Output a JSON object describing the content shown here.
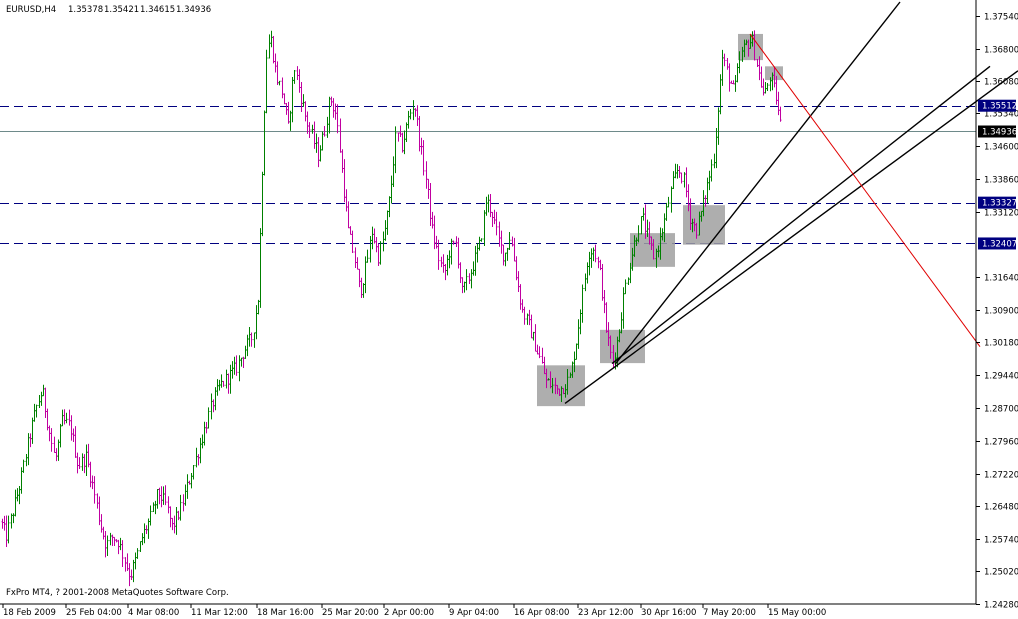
{
  "header": {
    "symbol": "EURUSD,H4",
    "open": "1.35378",
    "high": "1.35421",
    "low": "1.34615",
    "close": "1.34936"
  },
  "copyright": "FxPro MT4, ? 2001-2008 MetaQuotes Software Corp.",
  "colors": {
    "background": "#ffffff",
    "bull_bar": "#008000",
    "bear_bar": "#c000a0",
    "level_line": "#000080",
    "trendline": "#000000",
    "red_trendline": "#e00000",
    "box_fill": "#a0a0a0",
    "price_line": "#6e8a8a"
  },
  "chart_data": {
    "type": "ohlc",
    "title": "EURUSD,H4",
    "timeframe": "H4",
    "x_labels": [
      "18 Feb 2009",
      "25 Feb 04:00",
      "4 Mar 08:00",
      "11 Mar 12:00",
      "18 Mar 16:00",
      "25 Mar 20:00",
      "2 Apr 00:00",
      "9 Apr 04:00",
      "16 Apr 08:00",
      "23 Apr 12:00",
      "30 Apr 16:00",
      "7 May 20:00",
      "15 May 00:00"
    ],
    "y_ticks": [
      "1.37540",
      "1.36800",
      "1.36080",
      "1.35340",
      "1.34600",
      "1.33860",
      "1.33120",
      "1.31640",
      "1.30900",
      "1.30180",
      "1.29440",
      "1.28700",
      "1.27960",
      "1.27220",
      "1.26480",
      "1.25740",
      "1.25020",
      "1.24280"
    ],
    "ylim": [
      1.2428,
      1.3785
    ],
    "current_price": "1.34936",
    "horizontal_levels": [
      {
        "label": "1.35512",
        "value": 1.35512
      },
      {
        "label": "1.33327",
        "value": 1.33327
      },
      {
        "label": "1.32407",
        "value": 1.32407
      }
    ],
    "path": [
      [
        0,
        1.262
      ],
      [
        6,
        1.258
      ],
      [
        12,
        1.263
      ],
      [
        20,
        1.27
      ],
      [
        28,
        1.279
      ],
      [
        36,
        1.287
      ],
      [
        42,
        1.291
      ],
      [
        48,
        1.283
      ],
      [
        55,
        1.275
      ],
      [
        62,
        1.284
      ],
      [
        70,
        1.283
      ],
      [
        78,
        1.274
      ],
      [
        86,
        1.276
      ],
      [
        94,
        1.268
      ],
      [
        100,
        1.261
      ],
      [
        106,
        1.256
      ],
      [
        112,
        1.258
      ],
      [
        118,
        1.257
      ],
      [
        124,
        1.253
      ],
      [
        130,
        1.249
      ],
      [
        136,
        1.253
      ],
      [
        142,
        1.258
      ],
      [
        150,
        1.262
      ],
      [
        158,
        1.268
      ],
      [
        166,
        1.265
      ],
      [
        172,
        1.26
      ],
      [
        180,
        1.264
      ],
      [
        188,
        1.27
      ],
      [
        196,
        1.276
      ],
      [
        204,
        1.282
      ],
      [
        212,
        1.288
      ],
      [
        220,
        1.292
      ],
      [
        228,
        1.294
      ],
      [
        236,
        1.296
      ],
      [
        244,
        1.3
      ],
      [
        252,
        1.303
      ],
      [
        258,
        1.312
      ],
      [
        262,
        1.34
      ],
      [
        266,
        1.366
      ],
      [
        270,
        1.371
      ],
      [
        276,
        1.362
      ],
      [
        282,
        1.358
      ],
      [
        288,
        1.35
      ],
      [
        294,
        1.364
      ],
      [
        300,
        1.358
      ],
      [
        306,
        1.352
      ],
      [
        312,
        1.348
      ],
      [
        318,
        1.344
      ],
      [
        324,
        1.349
      ],
      [
        330,
        1.357
      ],
      [
        336,
        1.353
      ],
      [
        342,
        1.34
      ],
      [
        348,
        1.327
      ],
      [
        354,
        1.321
      ],
      [
        360,
        1.313
      ],
      [
        366,
        1.319
      ],
      [
        372,
        1.327
      ],
      [
        378,
        1.321
      ],
      [
        384,
        1.326
      ],
      [
        390,
        1.335
      ],
      [
        396,
        1.349
      ],
      [
        402,
        1.346
      ],
      [
        408,
        1.352
      ],
      [
        414,
        1.356
      ],
      [
        420,
        1.346
      ],
      [
        426,
        1.338
      ],
      [
        432,
        1.327
      ],
      [
        438,
        1.321
      ],
      [
        444,
        1.317
      ],
      [
        450,
        1.323
      ],
      [
        456,
        1.324
      ],
      [
        462,
        1.313
      ],
      [
        468,
        1.316
      ],
      [
        474,
        1.32
      ],
      [
        480,
        1.324
      ],
      [
        486,
        1.334
      ],
      [
        492,
        1.331
      ],
      [
        498,
        1.325
      ],
      [
        504,
        1.321
      ],
      [
        510,
        1.326
      ],
      [
        516,
        1.317
      ],
      [
        522,
        1.309
      ],
      [
        528,
        1.306
      ],
      [
        534,
        1.302
      ],
      [
        540,
        1.298
      ],
      [
        546,
        1.293
      ],
      [
        552,
        1.292
      ],
      [
        558,
        1.291
      ],
      [
        564,
        1.292
      ],
      [
        570,
        1.294
      ],
      [
        576,
        1.302
      ],
      [
        582,
        1.312
      ],
      [
        588,
        1.322
      ],
      [
        594,
        1.323
      ],
      [
        600,
        1.317
      ],
      [
        606,
        1.305
      ],
      [
        612,
        1.297
      ],
      [
        618,
        1.303
      ],
      [
        624,
        1.313
      ],
      [
        630,
        1.32
      ],
      [
        636,
        1.326
      ],
      [
        642,
        1.33
      ],
      [
        648,
        1.325
      ],
      [
        654,
        1.321
      ],
      [
        660,
        1.325
      ],
      [
        666,
        1.331
      ],
      [
        672,
        1.337
      ],
      [
        678,
        1.341
      ],
      [
        684,
        1.338
      ],
      [
        690,
        1.33
      ],
      [
        696,
        1.327
      ],
      [
        702,
        1.332
      ],
      [
        708,
        1.338
      ],
      [
        714,
        1.344
      ],
      [
        718,
        1.355
      ],
      [
        722,
        1.366
      ],
      [
        728,
        1.362
      ],
      [
        734,
        1.358
      ],
      [
        740,
        1.366
      ],
      [
        746,
        1.369
      ],
      [
        752,
        1.37
      ],
      [
        758,
        1.363
      ],
      [
        764,
        1.357
      ],
      [
        770,
        1.362
      ],
      [
        776,
        1.357
      ],
      [
        781,
        1.35
      ]
    ],
    "boxes": [
      {
        "t0": 537,
        "t1": 585,
        "p_low": 1.2874,
        "p_high": 1.2966
      },
      {
        "t0": 600,
        "t1": 645,
        "p_low": 1.2971,
        "p_high": 1.3046
      },
      {
        "t0": 630,
        "t1": 675,
        "p_low": 1.3188,
        "p_high": 1.3264
      },
      {
        "t0": 683,
        "t1": 725,
        "p_low": 1.3238,
        "p_high": 1.3327
      },
      {
        "t0": 738,
        "t1": 763,
        "p_low": 1.3654,
        "p_high": 1.3713
      },
      {
        "t0": 765,
        "t1": 783,
        "p_low": 1.3609,
        "p_high": 1.364
      }
    ],
    "trendlines": [
      {
        "t0": 565,
        "p0": 1.288,
        "t1": 1018,
        "p1": 1.363,
        "color": "black"
      },
      {
        "t0": 612,
        "p0": 1.297,
        "t1": 990,
        "p1": 1.364,
        "color": "black"
      },
      {
        "t0": 615,
        "p0": 1.2968,
        "t1": 900,
        "p1": 1.3785,
        "color": "black"
      },
      {
        "t0": 750,
        "p0": 1.3713,
        "t1": 980,
        "p1": 1.3008,
        "color": "red"
      }
    ]
  }
}
